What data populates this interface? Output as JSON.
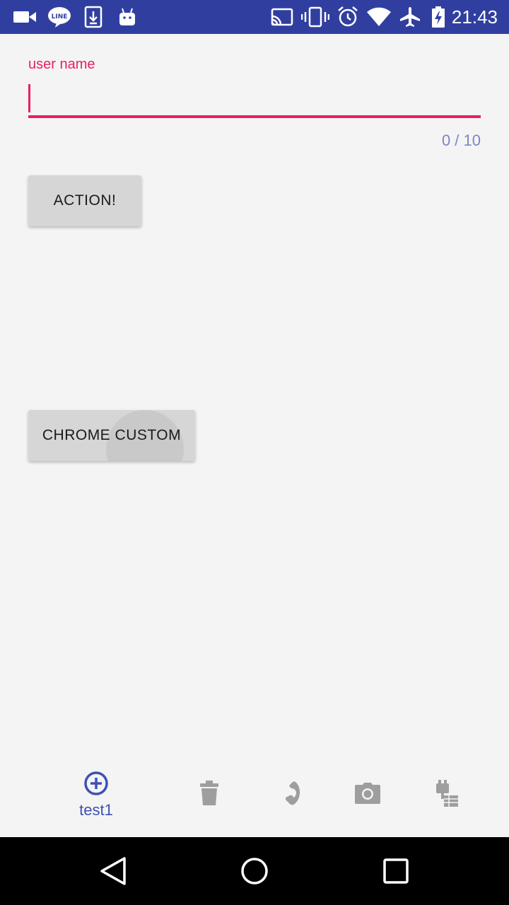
{
  "status_bar": {
    "time": "21:43",
    "left_icons": [
      "video-camera-icon",
      "line-app-icon",
      "download-icon",
      "android-icon"
    ],
    "right_icons": [
      "cast-icon",
      "vibrate-icon",
      "alarm-icon",
      "wifi-icon",
      "airplane-icon",
      "battery-charging-icon"
    ]
  },
  "form": {
    "username_label": "user name",
    "username_value": "",
    "char_counter": "0 / 10"
  },
  "buttons": {
    "action_label": "ACTION!",
    "chrome_custom_label": "CHROME CUSTOM"
  },
  "bottom_nav": {
    "items": [
      {
        "icon": "add-circle-icon",
        "label": "test1",
        "active": true
      },
      {
        "icon": "trash-icon",
        "label": "",
        "active": false
      },
      {
        "icon": "phone-icon",
        "label": "",
        "active": false
      },
      {
        "icon": "camera-icon",
        "label": "",
        "active": false
      },
      {
        "icon": "device-hub-icon",
        "label": "",
        "active": false
      }
    ]
  },
  "colors": {
    "status_bar": "#303f9f",
    "accent": "#e91e63",
    "primary": "#3f51b5",
    "counter": "#7986cb",
    "inactive_icon": "#9e9e9e"
  },
  "system_nav": [
    "back-icon",
    "home-icon",
    "recents-icon"
  ]
}
